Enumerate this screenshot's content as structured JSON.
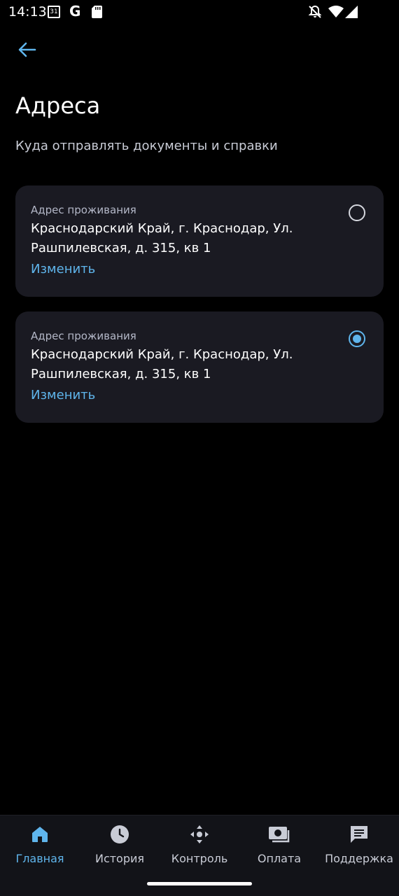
{
  "status_bar": {
    "time": "14:13",
    "calendar_day": "31",
    "g_letter": "G",
    "icons": [
      "calendar-icon",
      "google-icon",
      "sd-card-icon",
      "bell-off-icon",
      "wifi-icon",
      "signal-icon"
    ]
  },
  "header": {
    "back_icon": "arrow-left-icon",
    "title": "Адреса",
    "subtitle": "Куда отправлять документы и справки"
  },
  "addresses": [
    {
      "label": "Адрес проживания",
      "address": "Краснодарский Край, г. Краснодар, Ул. Рашпилевская, д. 315, кв 1",
      "edit_label": "Изменить",
      "selected": false
    },
    {
      "label": "Адрес проживания",
      "address": "Краснодарский Край, г. Краснодар, Ул. Рашпилевская, д. 315, кв 1",
      "edit_label": "Изменить",
      "selected": true
    }
  ],
  "bottom_nav": {
    "items": [
      {
        "label": "Главная",
        "icon": "home-icon",
        "active": true
      },
      {
        "label": "История",
        "icon": "clock-icon",
        "active": false
      },
      {
        "label": "Контроль",
        "icon": "control-icon",
        "active": false
      },
      {
        "label": "Оплата",
        "icon": "payment-icon",
        "active": false
      },
      {
        "label": "Поддержка",
        "icon": "chat-icon",
        "active": false
      }
    ]
  },
  "colors": {
    "accent": "#5fb5ec",
    "background": "#000000",
    "card": "#1a1a22",
    "nav": "#121318"
  }
}
